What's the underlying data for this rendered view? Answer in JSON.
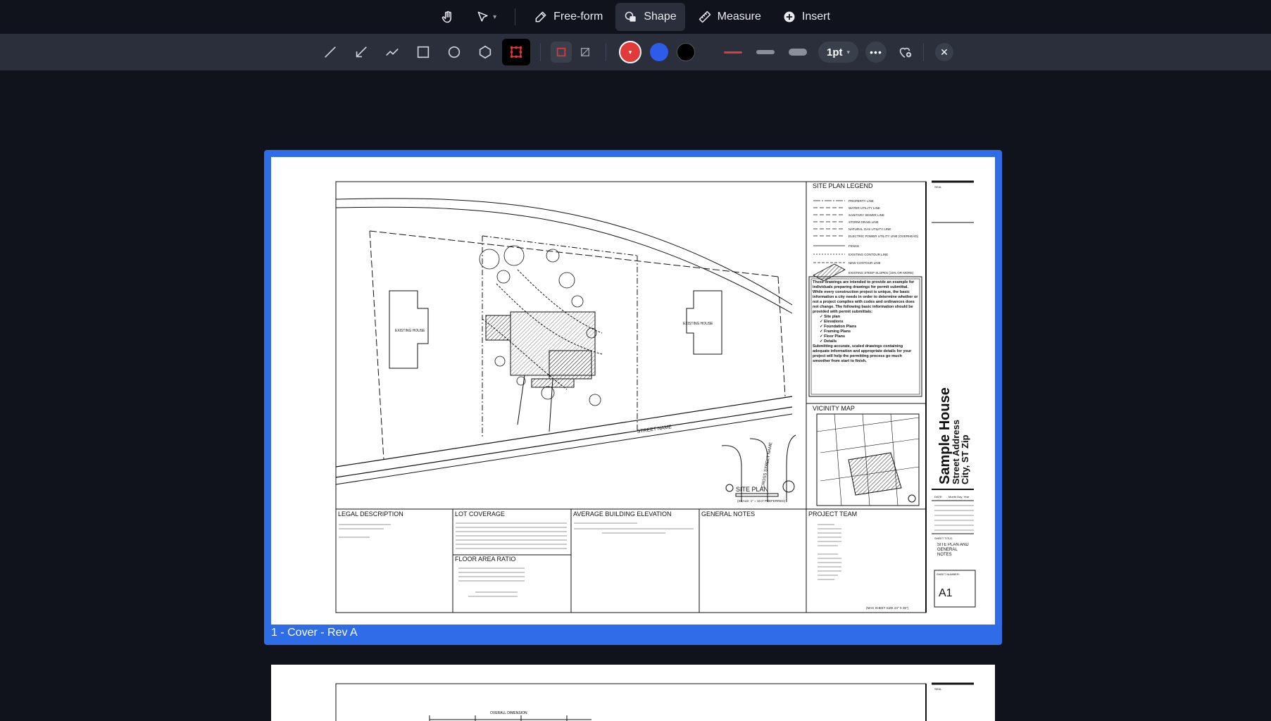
{
  "modebar": {
    "tools": [
      {
        "id": "hand",
        "icon": "hand-icon",
        "label": ""
      },
      {
        "id": "select",
        "icon": "cursor-arrow-icon",
        "label": ""
      },
      {
        "id": "freeform",
        "icon": "pen-icon",
        "label": "Free-form"
      },
      {
        "id": "shape",
        "icon": "shapes-icon",
        "label": "Shape"
      },
      {
        "id": "measure",
        "icon": "ruler-icon",
        "label": "Measure"
      },
      {
        "id": "insert",
        "icon": "plus-circle-icon",
        "label": "Insert"
      }
    ],
    "active": "Shape"
  },
  "toolbar": {
    "shape_tools": [
      "line-icon",
      "arrow-icon",
      "polyline-icon",
      "rectangle-icon",
      "ellipse-icon",
      "polygon-icon",
      "cloud-icon"
    ],
    "selected_shape": "cloud-icon",
    "colors": {
      "current": "#e03a3a",
      "blue": "#2e5bea",
      "black": "#000000",
      "stroke_red": "#e03a3a",
      "stroke_gray": "#8a8f99"
    },
    "stroke_size": "1pt"
  },
  "document": {
    "page1": {
      "caption": "1 - Cover - Rev A",
      "sheet": {
        "site_plan_legend": "SITE PLAN LEGEND",
        "legend_items": [
          "PROPERTY LINE",
          "WATER UTILITY LINE",
          "SANITARY SEWER LINE",
          "STORM DRAIN LINE",
          "NATURAL GAS UTILITY LINE",
          "ELECTRIC POWER UTILITY LINE (OVERHEAD)",
          "FENCE",
          "EXISTING CONTOUR LINE",
          "NEW CONTOUR LINE",
          "EXISTING STEEP SLOPES (15% OR MORE)"
        ],
        "note_text": "These drawings are intended to provide an example for individuals preparing drawings for permit submittal. While every construction project is unique, the basic information a city needs in order to determine whether or not a project complies with codes and ordinances does not change. The following basic information should be provided with permit submittals:",
        "checklist": [
          "Site plan",
          "Elevations",
          "Foundation Plans",
          "Framing Plans",
          "Floor Plans",
          "Details"
        ],
        "note_tail": "Submitting accurate, scaled drawings containing adequate information and appropriate details for your project will help the permitting process go much smoother from start to finish.",
        "vicinity_map": "VICINITY MAP",
        "existing_house": "EXISTING HOUSE",
        "street_name": "STREET NAME",
        "cross_street": "CROSS STREET NAME",
        "site_plan_title": "SITE PLAN",
        "site_plan_scale": "(SCALE: 1\" = 10.0' PREFERRED)",
        "legal_description": "LEGAL DESCRIPTION",
        "lot_coverage": "LOT COVERAGE",
        "floor_area_ratio": "FLOOR AREA RATIO",
        "avg_building_elevation": "AVERAGE BUILDING ELEVATION",
        "general_notes": "GENERAL NOTES",
        "project_team": "PROJECT TEAM",
        "project_name": "Sample House",
        "street_address": "Street Address",
        "city_line": "City, ST Zip",
        "seal": "SEAL",
        "date_label": "DATE:",
        "date_value": "Month Day, Year",
        "sheet_title_label": "SHEET TITLE:",
        "sheet_title": "SITE PLAN AND GENERAL NOTES",
        "sheet_number_label": "SHEET NUMBER:",
        "sheet_number": "A1",
        "max_sheet_size": "(MAX SHEET SIZE 24\" X 36\")",
        "page2_overall_dimension": "OVERALL DIMENSION"
      }
    }
  }
}
